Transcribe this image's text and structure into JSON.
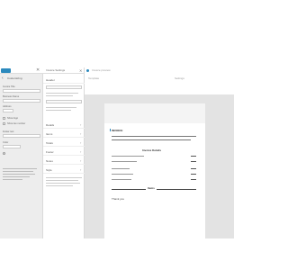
{
  "left_panel": {
    "publish_label": "",
    "close_icon": "close-icon",
    "back_icon": "chevron-left-icon",
    "back_label": "Customizing",
    "field_label_1": "Invoice Title",
    "field_label_2": "Business Name",
    "field_label_3": "Address",
    "option_label_1": "Show logo",
    "option_label_2": "Show tax number",
    "field_label_4": "Footer text",
    "field_label_5": "Color"
  },
  "mid_panel": {
    "title": "Invoice Settings",
    "close_icon": "close-icon",
    "rows": [
      {
        "label": "Header"
      },
      {
        "label": "Details"
      },
      {
        "label": "Items"
      },
      {
        "label": "Totals"
      },
      {
        "label": "Footer"
      },
      {
        "label": "Notes"
      },
      {
        "label": "Style"
      }
    ]
  },
  "editor": {
    "top_text_1": "Invoice preview",
    "top_text_2": "Template",
    "top_text_3": "Settings",
    "document": {
      "title": "INVOICE",
      "section_heading": "Invoice Details",
      "items_heading": "Items",
      "footer_text": "Thank you"
    }
  },
  "colors": {
    "accent": "#2b89bd",
    "panel_bg": "#ededed",
    "editor_bg": "#e3e3e3"
  }
}
